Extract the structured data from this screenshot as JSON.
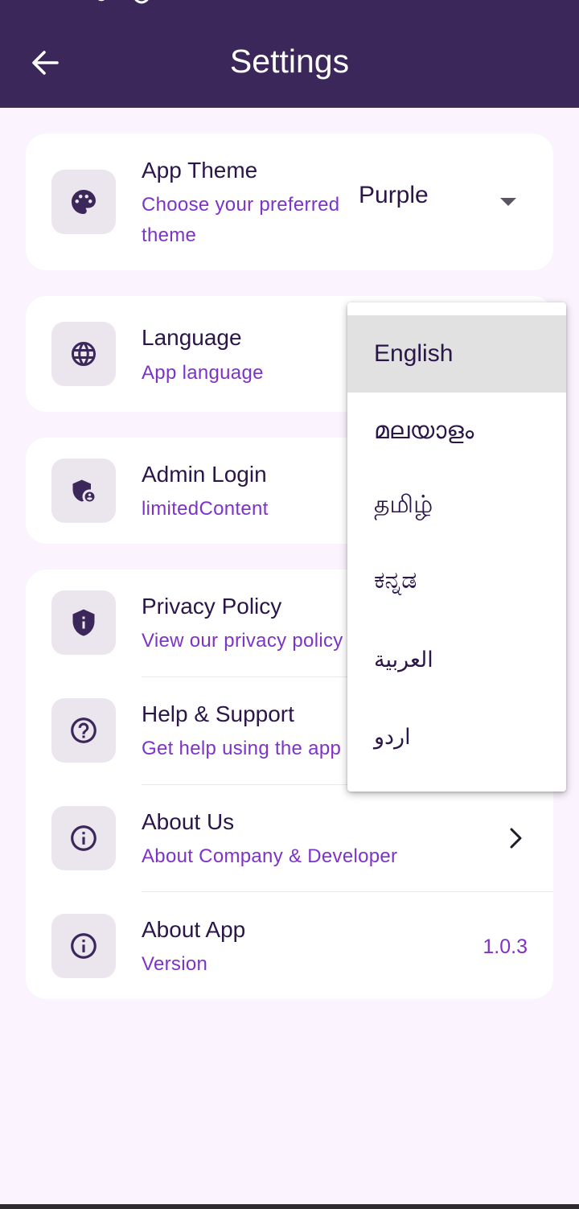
{
  "app": {
    "title": "Settings"
  },
  "theme_row": {
    "title": "App Theme",
    "subtitle_line1": "Choose your preferred",
    "subtitle_line2": "theme",
    "selected_value": "Purple",
    "icon": "palette-icon"
  },
  "language_row": {
    "title": "Language",
    "subtitle": "App language",
    "icon": "globe-icon"
  },
  "admin_row": {
    "title": "Admin Login",
    "subtitle": "limitedContent",
    "icon": "admin-shield-icon"
  },
  "info_rows": [
    {
      "title": "Privacy Policy",
      "subtitle": "View our privacy policy",
      "icon": "privacy-shield-icon"
    },
    {
      "title": "Help & Support",
      "subtitle": "Get help using the app",
      "icon": "help-circle-icon"
    },
    {
      "title": "About Us",
      "subtitle": "About Company & Developer",
      "icon": "info-icon"
    },
    {
      "title": "About App",
      "subtitle": "Version",
      "value": "1.0.3",
      "icon": "info-icon"
    }
  ],
  "language_menu": {
    "selected": "English",
    "options": [
      "English",
      "മലയാളം",
      "தமிழ்",
      "ಕನ್ನಡ",
      "العربية",
      "اردو"
    ]
  },
  "colors": {
    "appbar": "#3c275a",
    "background": "#fbf3fd",
    "accent": "#7d33c8",
    "title_text": "#2a1648"
  }
}
